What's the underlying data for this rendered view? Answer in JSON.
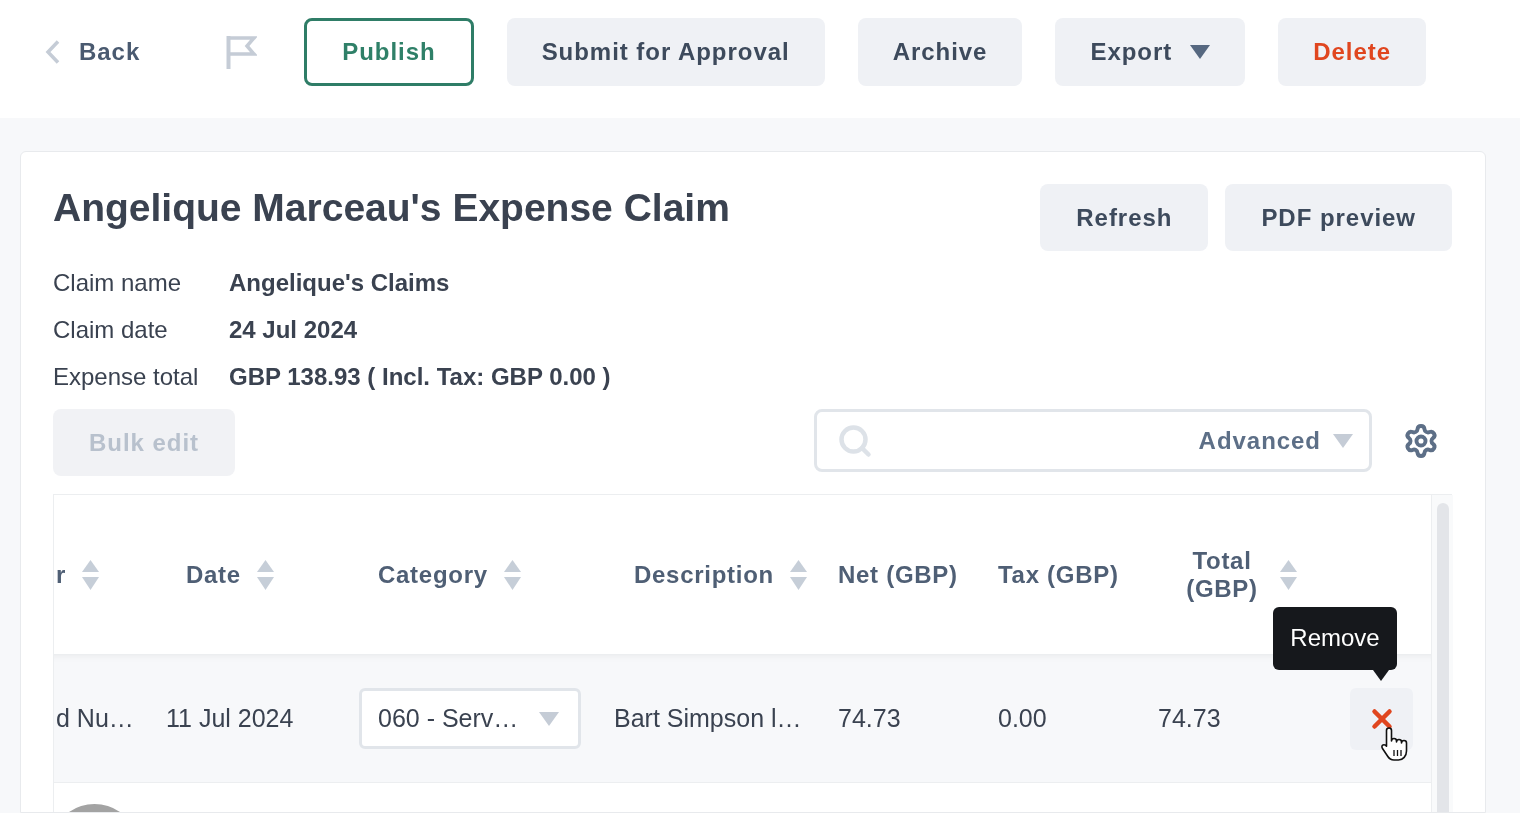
{
  "toolbar": {
    "back": {
      "label": "Back"
    },
    "buttons": [
      {
        "label": "Publish",
        "kind": "outline"
      },
      {
        "label": "Submit for Approval",
        "kind": "plain"
      },
      {
        "label": "Archive",
        "kind": "plain"
      },
      {
        "label": "Export",
        "kind": "dropdown"
      },
      {
        "label": "Delete",
        "kind": "danger"
      }
    ]
  },
  "claim": {
    "title": "Angelique Marceau's Expense Claim",
    "actions": [
      "Refresh",
      "PDF preview"
    ],
    "details": [
      {
        "label": "Claim name",
        "value": "Angelique's Claims"
      },
      {
        "label": "Claim date",
        "value": "24 Jul 2024"
      },
      {
        "label": "Expense total",
        "value": "GBP 138.93 ( Incl. Tax: GBP 0.00 )"
      }
    ],
    "bulk_edit": {
      "label": "Bulk edit",
      "disabled": true
    },
    "search": {
      "filter_label": "Advanced"
    },
    "table": {
      "columns": [
        {
          "label": "r",
          "sortable": true
        },
        {
          "label": "Date",
          "sortable": true
        },
        {
          "label": "Category",
          "sortable": true
        },
        {
          "label": "Description",
          "sortable": true
        },
        {
          "label": "Net (GBP)",
          "sortable": false
        },
        {
          "label": "Tax (GBP)",
          "sortable": false
        },
        {
          "label": "Total (GBP)",
          "sortable": true
        }
      ],
      "rows": [
        {
          "cells": [
            {
              "kind": "text",
              "value": "d Nu…"
            },
            {
              "kind": "text",
              "value": "11 Jul 2024"
            },
            {
              "kind": "select",
              "value": "060 - Serv…"
            },
            {
              "kind": "text",
              "value": "Bart Simpson l…"
            },
            {
              "kind": "text",
              "value": "74.73"
            },
            {
              "kind": "text",
              "value": "0.00"
            },
            {
              "kind": "text",
              "value": "74.73"
            },
            {
              "kind": "remove",
              "tooltip": "Remove"
            }
          ]
        }
      ]
    }
  }
}
